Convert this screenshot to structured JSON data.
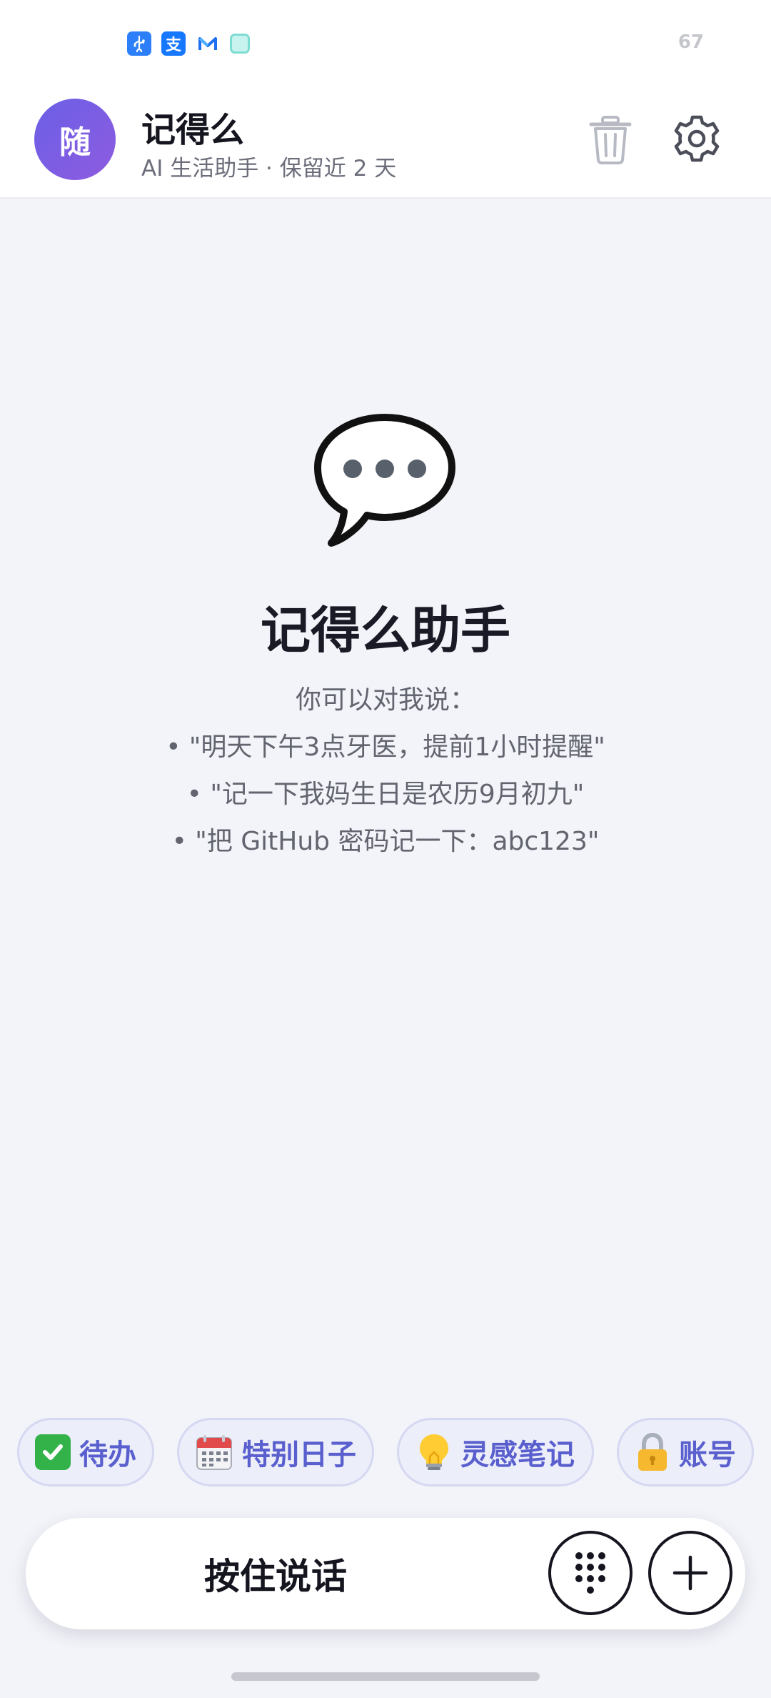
{
  "status_bar": {
    "icons": [
      "usb-icon",
      "alipay-icon",
      "mail-icon",
      "app-icon"
    ],
    "alipay_glyph": "支",
    "usb_glyph": "⚲",
    "mail_glyph": "M",
    "battery": "67"
  },
  "header": {
    "avatar_text": "随",
    "title": "记得么",
    "subtitle": "AI 生活助手 · 保留近 2 天",
    "actions": [
      "trash-icon",
      "gear-icon"
    ]
  },
  "empty_state": {
    "icon": "speech-bubble-icon",
    "title": "记得么助手",
    "lead": "你可以对我说：",
    "hints": [
      "• \"明天下午3点牙医，提前1小时提醒\"",
      "• \"记一下我妈生日是农历9月初九\"",
      "• \"把 GitHub 密码记一下：abc123\""
    ]
  },
  "chips": [
    {
      "icon": "check-mark-icon",
      "label": "待办"
    },
    {
      "icon": "calendar-icon",
      "label": "特别日子"
    },
    {
      "icon": "lightbulb-icon",
      "label": "灵感笔记"
    },
    {
      "icon": "lock-icon",
      "label": "账号"
    }
  ],
  "input_bar": {
    "hold_to_talk": "按住说话",
    "keypad_icon": "keypad-icon",
    "plus_icon": "plus-icon"
  },
  "colors": {
    "accent": "#5a5fce",
    "avatar_start": "#6a60e6",
    "avatar_end": "#8e5be0",
    "background": "#f3f4f9"
  }
}
